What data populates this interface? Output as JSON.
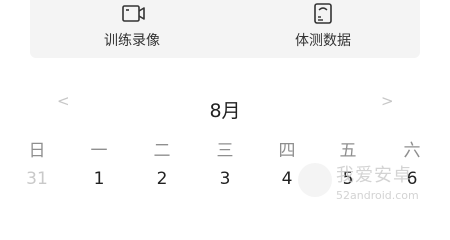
{
  "quick_actions": {
    "training_video_label": "训练录像",
    "body_test_label": "体测数据"
  },
  "calendar": {
    "month_title": "8月",
    "prev_symbol": "<",
    "next_symbol": ">",
    "weekdays": [
      "日",
      "一",
      "二",
      "三",
      "四",
      "五",
      "六"
    ],
    "week1": [
      "31",
      "1",
      "2",
      "3",
      "4",
      "5",
      "6"
    ]
  },
  "watermark": {
    "title": "我爱安卓",
    "url": "52android.com"
  }
}
